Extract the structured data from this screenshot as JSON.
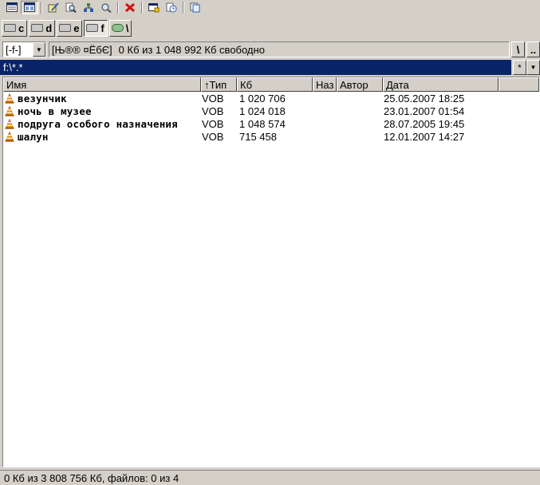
{
  "toolbar": {
    "buttons": [
      "view-brief-icon",
      "view-full-icon",
      "edit-icon",
      "search-icon",
      "tree-icon",
      "zoom-icon",
      "delete-icon",
      "window-icon",
      "history-icon",
      "copy-icon"
    ]
  },
  "drives": [
    {
      "letter": "c",
      "icon": "hard-drive-icon"
    },
    {
      "letter": "d",
      "icon": "hard-drive-icon"
    },
    {
      "letter": "e",
      "icon": "hard-drive-icon"
    },
    {
      "letter": "f",
      "icon": "hard-drive-icon"
    },
    {
      "letter": "\\",
      "icon": "network-icon"
    }
  ],
  "info": {
    "drive_select": "[-f-]",
    "volume_label": "[Њ®® ¤ЁбЄ]",
    "free_space": "0 Кб из 1 048 992 Кб свободно",
    "root_button": "\\",
    "up_button": ".."
  },
  "path": {
    "value": "f:\\*.*",
    "filter_button": "*",
    "dropdown": "▼"
  },
  "columns": {
    "name": "Имя",
    "type": "↑Тип",
    "size": "Кб",
    "extra": "Наз",
    "author": "Автор",
    "date": "Дата"
  },
  "files": [
    {
      "name": "везунчик",
      "type": "VOB",
      "size": "1 020 706",
      "date": "25.05.2007 18:25"
    },
    {
      "name": "ночь в музее",
      "type": "VOB",
      "size": "1 024 018",
      "date": "23.01.2007 01:54"
    },
    {
      "name": "подруга особого назначения",
      "type": "VOB",
      "size": "1 048 574",
      "date": "28.07.2005 19:45"
    },
    {
      "name": "шалун",
      "type": "VOB",
      "size": "715 458",
      "date": "12.01.2007 14:27"
    }
  ],
  "status": {
    "text": "0 Кб из 3 808 756 Кб, файлов: 0 из 4"
  },
  "colors": {
    "path_bg": "#0a246a",
    "vlc_orange": "#f28c00"
  }
}
